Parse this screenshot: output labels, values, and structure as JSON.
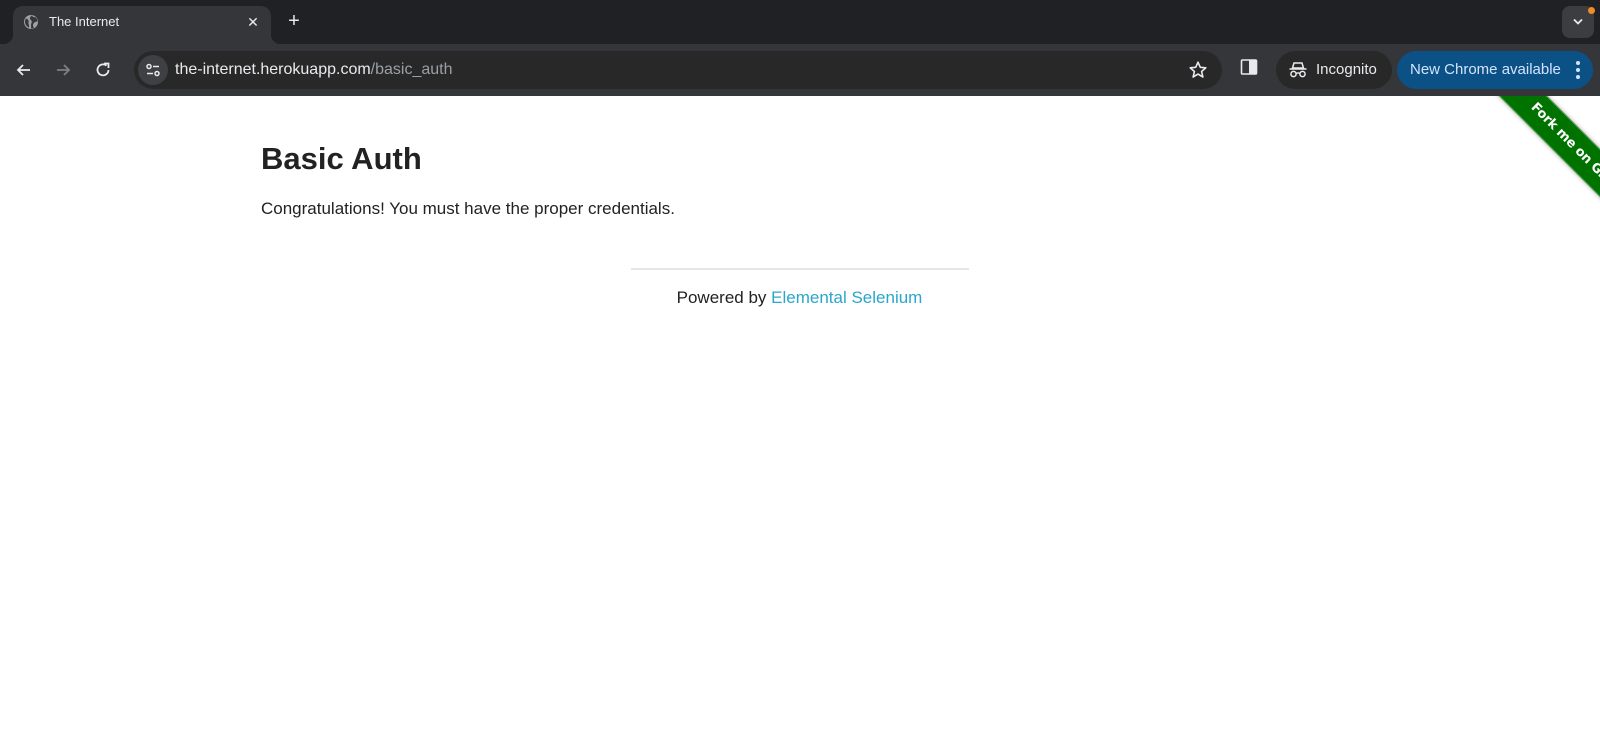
{
  "browser": {
    "tabs": [
      {
        "title": "The Internet",
        "favicon": "globe-icon",
        "active": true
      }
    ],
    "new_tab_icon": "plus-icon",
    "tab_search_icon": "chevron-down-icon",
    "address_bar": {
      "host": "the-internet.herokuapp.com",
      "path": "/basic_auth"
    },
    "incognito_label": "Incognito",
    "update_label": "New Chrome available",
    "colors": {
      "update_button": "#0b5186",
      "notification_dot": "#f28b24"
    }
  },
  "page": {
    "heading": "Basic Auth",
    "message": "Congratulations! You must have the proper credentials.",
    "footer": {
      "prefix": "Powered by ",
      "link_text": "Elemental Selenium"
    },
    "ribbon_text": "Fork me on GitHub",
    "colors": {
      "link": "#2ba6cb",
      "ribbon": "#007200"
    }
  }
}
